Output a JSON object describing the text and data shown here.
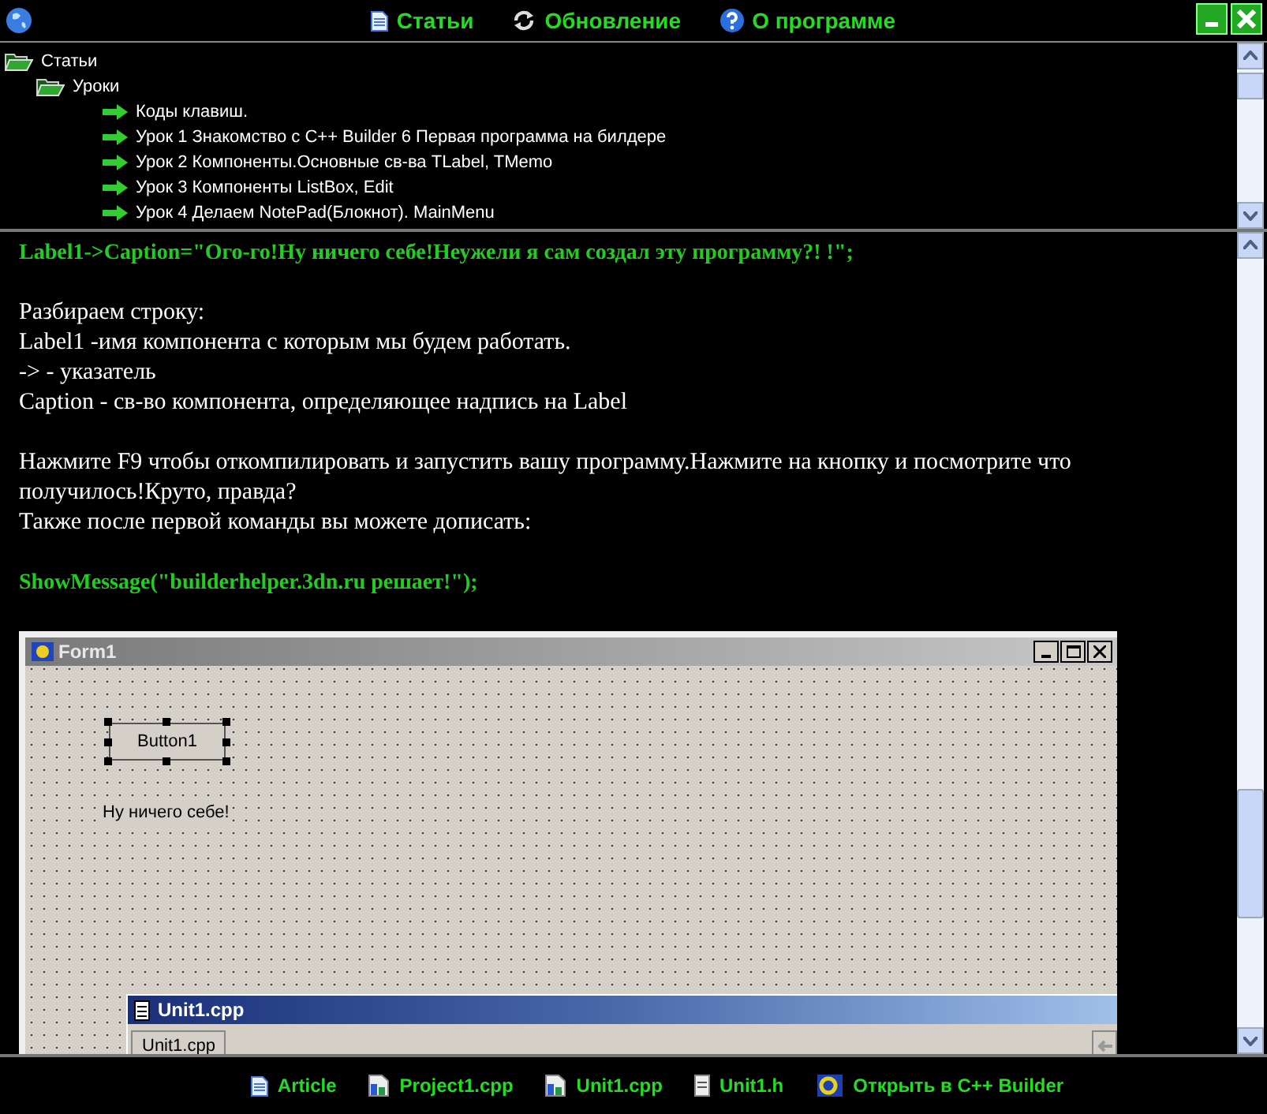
{
  "top_nav": [
    {
      "label": "Статьи"
    },
    {
      "label": "Обновление"
    },
    {
      "label": "О программе"
    }
  ],
  "tree": [
    {
      "label": "Статьи",
      "kind": "folder",
      "expanded": true,
      "children": [
        {
          "label": "Уроки",
          "kind": "folder",
          "expanded": true,
          "children": [
            {
              "label": "Коды клавиш.",
              "kind": "leaf"
            },
            {
              "label": "Урок 1 Знакомство с C++ Builder 6 Первая программа на билдере",
              "kind": "leaf"
            },
            {
              "label": "Урок 2  Компоненты.Основные св-ва  TLabel, TMemo",
              "kind": "leaf"
            },
            {
              "label": "Урок 3  Компоненты  ListBox, Edit",
              "kind": "leaf"
            },
            {
              "label": "Урок 4  Делаем NotePad(Блокнот). MainMenu",
              "kind": "leaf"
            }
          ]
        }
      ]
    }
  ],
  "article": [
    {
      "kind": "code",
      "text": "Label1->Caption=\"Ого-го!Ну ничего себе!Неужели я сам создал эту программу?! !\";"
    },
    {
      "kind": "gap"
    },
    {
      "kind": "text",
      "text": "Разбираем строку:"
    },
    {
      "kind": "text",
      "text": "Label1 -имя компонента с которым мы будем работать."
    },
    {
      "kind": "text",
      "text": "-> - указатель"
    },
    {
      "kind": "text",
      "text": "Caption - св-во компонента, определяющее надпись на Label"
    },
    {
      "kind": "gap"
    },
    {
      "kind": "text",
      "text": "Нажмите F9 чтобы откомпилировать и запустить вашу программу.Нажмите на кнопку и посмотрите что получилось!Круто, правда?"
    },
    {
      "kind": "text",
      "text": "Также после первой команды вы можете дописать:"
    },
    {
      "kind": "gap"
    },
    {
      "kind": "code",
      "text": "ShowMessage(\"builderhelper.3dn.ru решает!\");"
    }
  ],
  "ide_screenshot": {
    "form_title": "Form1",
    "button_label": "Button1",
    "label_text": "Ну ничего себе!",
    "editor_title": "Unit1.cpp",
    "editor_tab": "Unit1.cpp"
  },
  "bottom_links": [
    {
      "label": "Article"
    },
    {
      "label": "Project1.cpp"
    },
    {
      "label": "Unit1.cpp"
    },
    {
      "label": "Unit1.h"
    },
    {
      "label": "Открыть в C++ Builder"
    }
  ]
}
